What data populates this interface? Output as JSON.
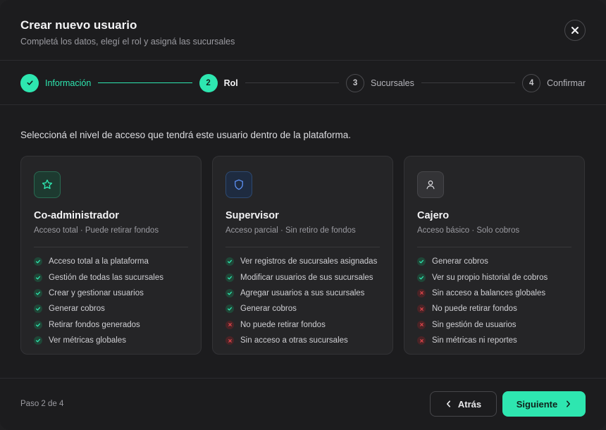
{
  "header": {
    "title": "Crear nuevo usuario",
    "subtitle": "Completá los datos, elegí el rol y asigná las sucursales",
    "close_icon": "close-icon"
  },
  "stepper": {
    "steps": [
      {
        "number": "1",
        "label": "Información",
        "state": "done"
      },
      {
        "number": "2",
        "label": "Rol",
        "state": "active"
      },
      {
        "number": "3",
        "label": "Sucursales",
        "state": "todo"
      },
      {
        "number": "4",
        "label": "Confirmar",
        "state": "todo"
      }
    ]
  },
  "intro": "Seleccioná el nivel de acceso que tendrá este usuario dentro de la plataforma.",
  "roles": [
    {
      "icon": "star-icon",
      "title": "Co-administrador",
      "subtitle": "Acceso total · Puede retirar fondos",
      "features": [
        {
          "text": "Acceso total a la plataforma",
          "allowed": true
        },
        {
          "text": "Gestión de todas las sucursales",
          "allowed": true
        },
        {
          "text": "Crear y gestionar usuarios",
          "allowed": true
        },
        {
          "text": "Generar cobros",
          "allowed": true
        },
        {
          "text": "Retirar fondos generados",
          "allowed": true
        },
        {
          "text": "Ver métricas globales",
          "allowed": true
        }
      ]
    },
    {
      "icon": "shield-icon",
      "title": "Supervisor",
      "subtitle": "Acceso parcial · Sin retiro de fondos",
      "features": [
        {
          "text": "Ver registros de sucursales asignadas",
          "allowed": true
        },
        {
          "text": "Modificar usuarios de sus sucursales",
          "allowed": true
        },
        {
          "text": "Agregar usuarios a sus sucursales",
          "allowed": true
        },
        {
          "text": "Generar cobros",
          "allowed": true
        },
        {
          "text": "No puede retirar fondos",
          "allowed": false
        },
        {
          "text": "Sin acceso a otras sucursales",
          "allowed": false
        }
      ]
    },
    {
      "icon": "user-icon",
      "title": "Cajero",
      "subtitle": "Acceso básico · Solo cobros",
      "features": [
        {
          "text": "Generar cobros",
          "allowed": true
        },
        {
          "text": "Ver su propio historial de cobros",
          "allowed": true
        },
        {
          "text": "Sin acceso a balances globales",
          "allowed": false
        },
        {
          "text": "No puede retirar fondos",
          "allowed": false
        },
        {
          "text": "Sin gestión de usuarios",
          "allowed": false
        },
        {
          "text": "Sin métricas ni reportes",
          "allowed": false
        }
      ]
    }
  ],
  "footer": {
    "step_count": "Paso 2 de 4",
    "back_label": "Atrás",
    "next_label": "Siguiente"
  },
  "colors": {
    "accent": "#2ee6b0",
    "background": "#1c1c1e",
    "card": "#252527",
    "check": "#2ee6b0",
    "cross": "#e5484d"
  }
}
